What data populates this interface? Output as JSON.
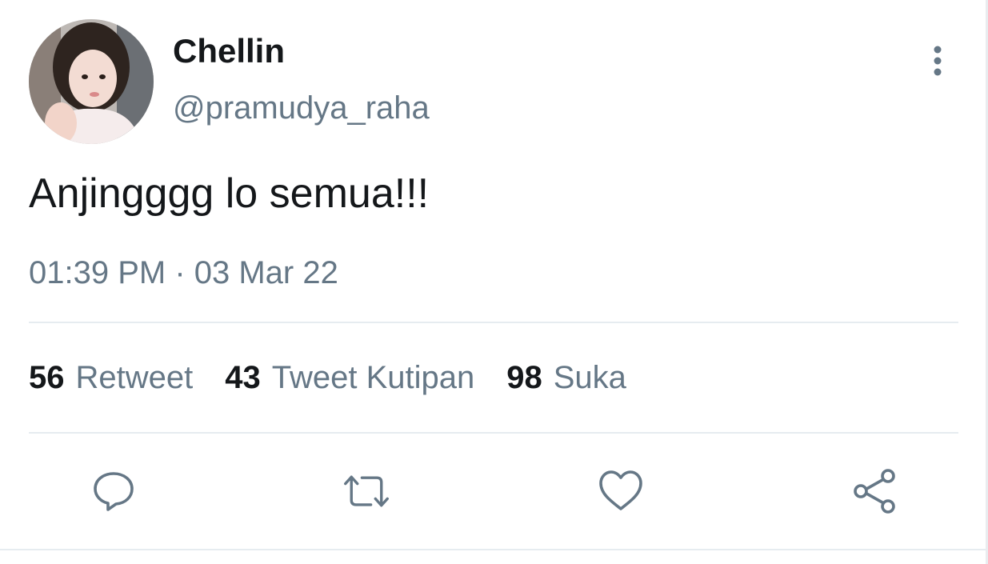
{
  "tweet": {
    "display_name": "Chellin",
    "handle": "@pramudya_raha",
    "text": "Anjingggg lo semua!!!",
    "timestamp": "01:39 PM · 03 Mar 22"
  },
  "stats": {
    "retweets": {
      "count": "56",
      "label": "Retweet"
    },
    "quotes": {
      "count": "43",
      "label": "Tweet Kutipan"
    },
    "likes": {
      "count": "98",
      "label": "Suka"
    }
  },
  "icons": {
    "more": "more-vertical-icon",
    "reply": "reply-icon",
    "retweet": "retweet-icon",
    "like": "heart-icon",
    "share": "share-icon"
  },
  "colors": {
    "text_primary": "#14171a",
    "text_secondary": "#657786",
    "divider": "#e6ecf0"
  }
}
